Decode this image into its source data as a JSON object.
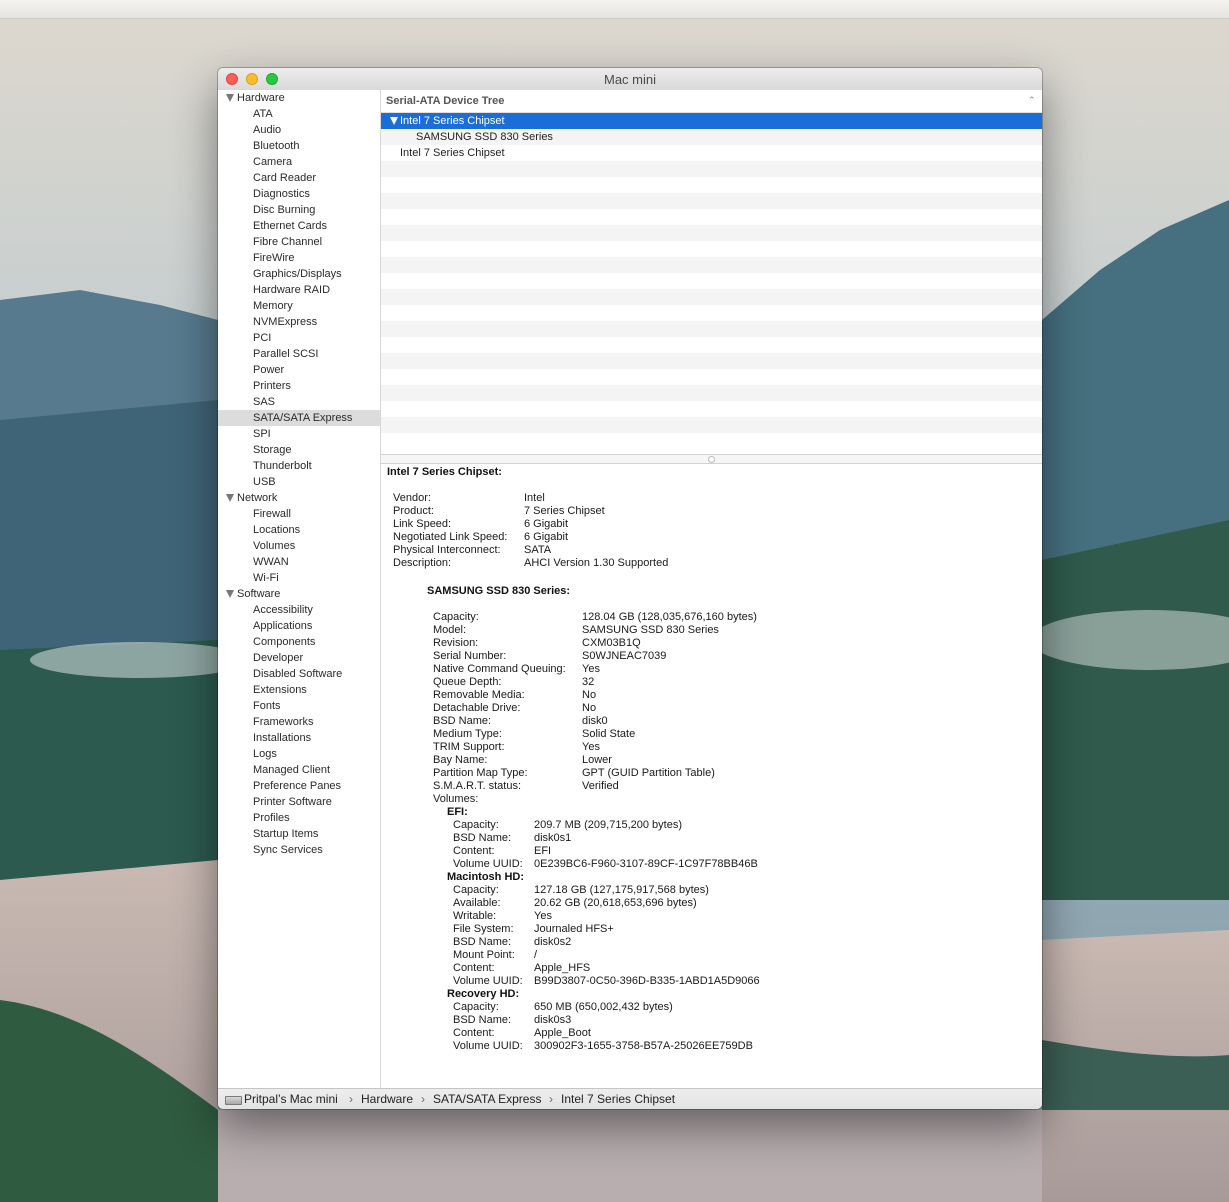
{
  "window": {
    "title": "Mac mini"
  },
  "sidebar": {
    "groups": [
      {
        "label": "Hardware",
        "items": [
          "ATA",
          "Audio",
          "Bluetooth",
          "Camera",
          "Card Reader",
          "Diagnostics",
          "Disc Burning",
          "Ethernet Cards",
          "Fibre Channel",
          "FireWire",
          "Graphics/Displays",
          "Hardware RAID",
          "Memory",
          "NVMExpress",
          "PCI",
          "Parallel SCSI",
          "Power",
          "Printers",
          "SAS",
          "SATA/SATA Express",
          "SPI",
          "Storage",
          "Thunderbolt",
          "USB"
        ]
      },
      {
        "label": "Network",
        "items": [
          "Firewall",
          "Locations",
          "Volumes",
          "WWAN",
          "Wi-Fi"
        ]
      },
      {
        "label": "Software",
        "items": [
          "Accessibility",
          "Applications",
          "Components",
          "Developer",
          "Disabled Software",
          "Extensions",
          "Fonts",
          "Frameworks",
          "Installations",
          "Logs",
          "Managed Client",
          "Preference Panes",
          "Printer Software",
          "Profiles",
          "Startup Items",
          "Sync Services"
        ]
      }
    ],
    "selected": "SATA/SATA Express"
  },
  "tree": {
    "header": "Serial-ATA Device Tree",
    "rows": [
      {
        "label": "Intel 7 Series Chipset",
        "level": 0,
        "expanded": true,
        "selected": true
      },
      {
        "label": "SAMSUNG SSD 830 Series",
        "level": 1
      },
      {
        "label": "Intel 7 Series Chipset",
        "level": 0
      }
    ]
  },
  "detail": {
    "title": "Intel 7 Series Chipset:",
    "controller": [
      [
        "Vendor:",
        "Intel"
      ],
      [
        "Product:",
        "7 Series Chipset"
      ],
      [
        "Link Speed:",
        "6 Gigabit"
      ],
      [
        "Negotiated Link Speed:",
        "6 Gigabit"
      ],
      [
        "Physical Interconnect:",
        "SATA"
      ],
      [
        "Description:",
        "AHCI Version 1.30 Supported"
      ]
    ],
    "device_title": "SAMSUNG SSD 830 Series:",
    "device": [
      [
        "Capacity:",
        "128.04 GB (128,035,676,160 bytes)"
      ],
      [
        "Model:",
        "SAMSUNG SSD 830 Series"
      ],
      [
        "Revision:",
        "CXM03B1Q"
      ],
      [
        "Serial Number:",
        "S0WJNEAC7039"
      ],
      [
        "Native Command Queuing:",
        "Yes"
      ],
      [
        "Queue Depth:",
        "32"
      ],
      [
        "Removable Media:",
        "No"
      ],
      [
        "Detachable Drive:",
        "No"
      ],
      [
        "BSD Name:",
        "disk0"
      ],
      [
        "Medium Type:",
        "Solid State"
      ],
      [
        "TRIM Support:",
        "Yes"
      ],
      [
        "Bay Name:",
        "Lower"
      ],
      [
        "Partition Map Type:",
        "GPT (GUID Partition Table)"
      ],
      [
        "S.M.A.R.T. status:",
        "Verified"
      ],
      [
        "Volumes:",
        ""
      ]
    ],
    "volumes": [
      {
        "name": "EFI:",
        "props": [
          [
            "Capacity:",
            "209.7 MB (209,715,200 bytes)"
          ],
          [
            "BSD Name:",
            "disk0s1"
          ],
          [
            "Content:",
            "EFI"
          ],
          [
            "Volume UUID:",
            "0E239BC6-F960-3107-89CF-1C97F78BB46B"
          ]
        ]
      },
      {
        "name": "Macintosh HD:",
        "props": [
          [
            "Capacity:",
            "127.18 GB (127,175,917,568 bytes)"
          ],
          [
            "Available:",
            "20.62 GB (20,618,653,696 bytes)"
          ],
          [
            "Writable:",
            "Yes"
          ],
          [
            "File System:",
            "Journaled HFS+"
          ],
          [
            "BSD Name:",
            "disk0s2"
          ],
          [
            "Mount Point:",
            "/"
          ],
          [
            "Content:",
            "Apple_HFS"
          ],
          [
            "Volume UUID:",
            "B99D3807-0C50-396D-B335-1ABD1A5D9066"
          ]
        ]
      },
      {
        "name": "Recovery HD:",
        "props": [
          [
            "Capacity:",
            "650 MB (650,002,432 bytes)"
          ],
          [
            "BSD Name:",
            "disk0s3"
          ],
          [
            "Content:",
            "Apple_Boot"
          ],
          [
            "Volume UUID:",
            "300902F3-1655-3758-B57A-25026EE759DB"
          ]
        ]
      }
    ]
  },
  "pathbar": {
    "icon": "computer-icon",
    "crumbs": [
      "Pritpal’s Mac mini",
      "Hardware",
      "SATA/SATA Express",
      "Intel 7 Series Chipset"
    ],
    "separator": "›"
  },
  "colors": {
    "selection": "#1b6ed8",
    "sidebar_selected": "#dcdcdc",
    "close": "#fc5f57",
    "minimize": "#fdbc2e",
    "zoom": "#28c840"
  }
}
